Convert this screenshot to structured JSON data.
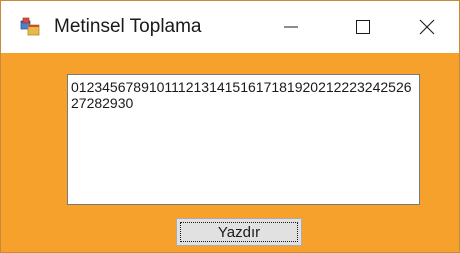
{
  "window": {
    "title": "Metinsel Toplama",
    "icon": "app-window-icon",
    "controls": {
      "minimize_icon": "minimize-icon",
      "maximize_icon": "maximize-icon",
      "close_icon": "close-icon"
    },
    "background_color": "#f5a12c"
  },
  "main": {
    "output_text": "01234567891011121314151617181920212223242526272829​30",
    "print_button_label": "Yazdır"
  }
}
